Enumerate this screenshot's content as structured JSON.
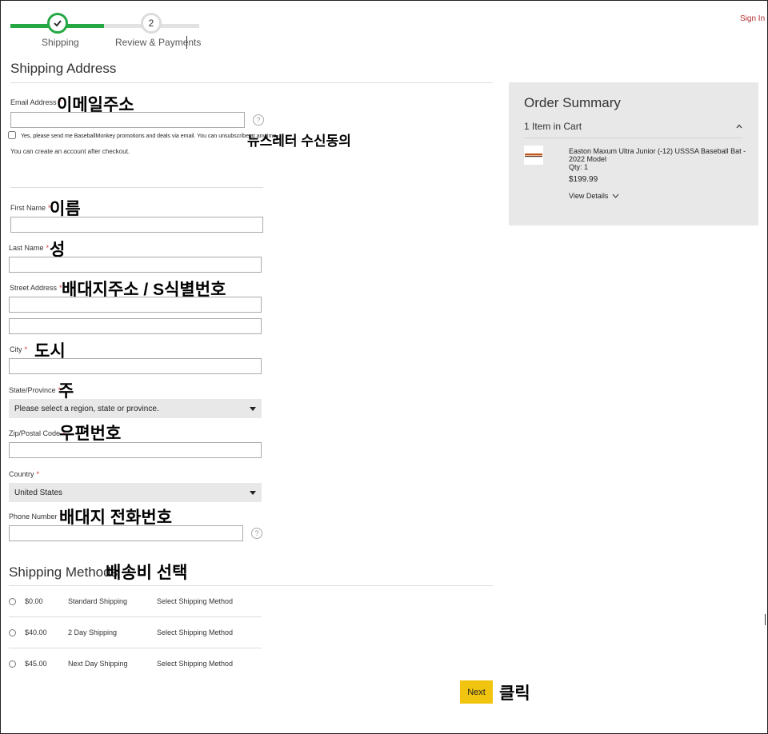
{
  "header": {
    "sign_in": "Sign In",
    "steps": [
      {
        "number": "",
        "label": "Shipping",
        "status": "done"
      },
      {
        "number": "2",
        "label": "Review & Payments",
        "status": "pending"
      }
    ]
  },
  "shipping_address": {
    "title": "Shipping Address",
    "email": {
      "label": "Email Address",
      "required": "*",
      "value": "",
      "annotation": "이메일주소"
    },
    "newsletter": {
      "text": "Yes, please send me BaseballMonkey promotions and deals via email. You can unsubscribe at anytime.",
      "checked": false,
      "annotation": "뉴스레터 수신동의"
    },
    "account_note": "You can create an account after checkout.",
    "first_name": {
      "label": "First Name",
      "required": "*",
      "value": "",
      "annotation": "이름"
    },
    "last_name": {
      "label": "Last Name",
      "required": "*",
      "value": "",
      "annotation": "성"
    },
    "street": {
      "label": "Street Address",
      "required": "*",
      "value1": "",
      "value2": "",
      "annotation": "배대지주소 / S식별번호"
    },
    "city": {
      "label": "City",
      "required": "*",
      "value": "",
      "annotation": "도시"
    },
    "state": {
      "label": "State/Province",
      "required": "*",
      "selected": "Please select a region, state or province.",
      "annotation": "주"
    },
    "zip": {
      "label": "Zip/Postal Code",
      "required": "*",
      "value": "",
      "annotation": "우편번호"
    },
    "country": {
      "label": "Country",
      "required": "*",
      "selected": "United States"
    },
    "phone": {
      "label": "Phone Number",
      "required": "*",
      "value": "",
      "annotation": "배대지 전화번호"
    },
    "help_glyph": "?"
  },
  "shipping_methods": {
    "title": "Shipping Methods",
    "annotation": "배송비 선택",
    "options": [
      {
        "price": "$0.00",
        "name": "Standard Shipping",
        "action": "Select Shipping Method"
      },
      {
        "price": "$40.00",
        "name": "2 Day Shipping",
        "action": "Select Shipping Method"
      },
      {
        "price": "$45.00",
        "name": "Next Day Shipping",
        "action": "Select Shipping Method"
      }
    ]
  },
  "order_summary": {
    "title": "Order Summary",
    "items_in_cart": "1 Item in Cart",
    "item": {
      "name": "Easton Maxum Ultra Junior (-12) USSSA Baseball Bat - 2022 Model",
      "qty": "Qty: 1",
      "price": "$199.99",
      "details_label": "View Details"
    }
  },
  "actions": {
    "next_label": "Next",
    "annotation": "클릭"
  },
  "colors": {
    "progress": "#25a844",
    "next_button": "#f1c40f",
    "required": "#dd3333",
    "sign_in": "#b03030"
  }
}
